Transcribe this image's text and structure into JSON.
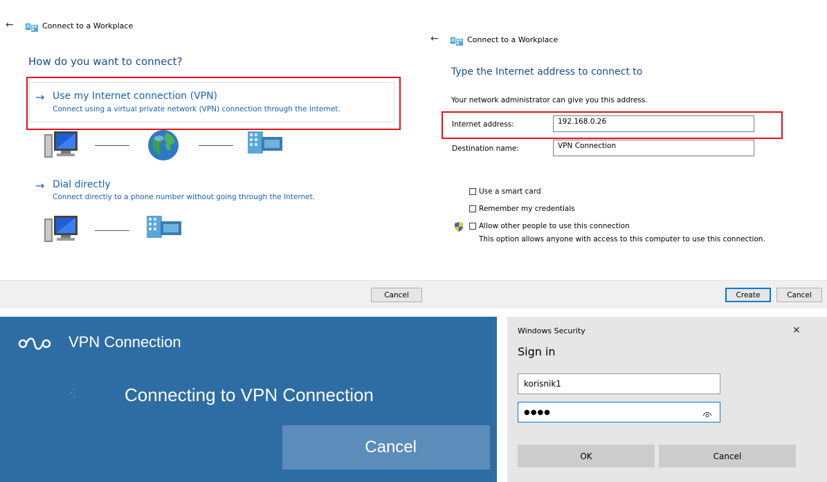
{
  "wizard1": {
    "back": "←",
    "title": "Connect to a Workplace",
    "question": "How do you want to connect?",
    "option_vpn_title": "Use my Internet connection (VPN)",
    "option_vpn_desc": "Connect using a virtual private network (VPN) connection through the Internet.",
    "option_dial_title": "Dial directly",
    "option_dial_desc": "Connect directly to a phone number without going through the Internet.",
    "cancel": "Cancel"
  },
  "wizard2": {
    "back": "←",
    "title": "Connect to a Workplace",
    "heading": "Type the Internet address to connect to",
    "hint": "Your network administrator can give you this address.",
    "address_label": "Internet address:",
    "address_value": "192.168.0.26",
    "dest_label": "Destination name:",
    "dest_value": "VPN Connection",
    "smart_card": "Use a smart card",
    "remember": "Remember my credentials",
    "allow_others": "Allow other people to use this connection",
    "allow_others_desc": "This option allows anyone with access to this computer to use this connection.",
    "create": "Create",
    "cancel": "Cancel"
  },
  "vpn": {
    "title": "VPN Connection",
    "status": "Connecting to VPN Connection",
    "cancel": "Cancel"
  },
  "security": {
    "caption": "Windows Security",
    "close": "✕",
    "title": "Sign in",
    "username": "korisnik1",
    "password_mask": "●●●●",
    "ok": "OK",
    "cancel": "Cancel"
  },
  "colors": {
    "accent_blue": "#1560b8",
    "highlight_red": "#e0101a",
    "vpn_bg": "#2e6da4",
    "dialog_bg": "#e6e6e6"
  }
}
